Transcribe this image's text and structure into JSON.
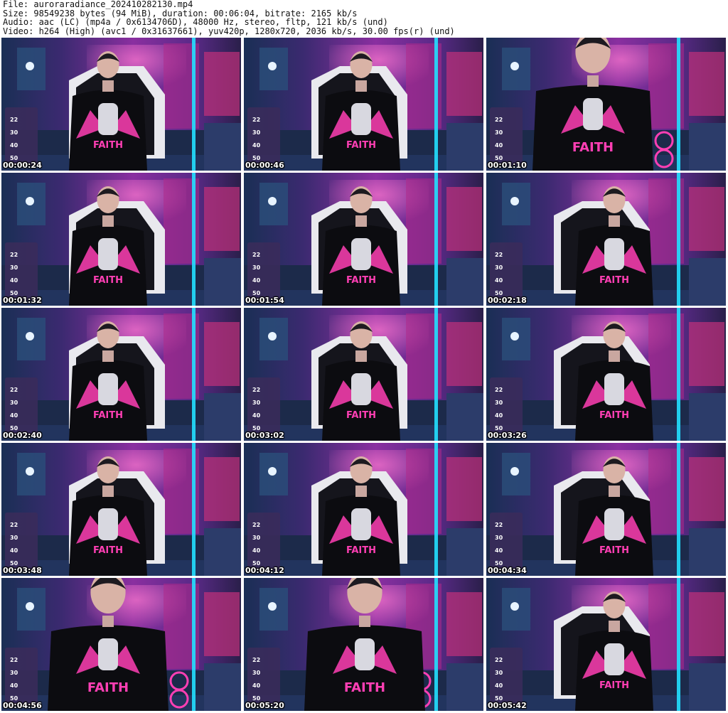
{
  "header": {
    "file": "File: auroraradiance_202410282130.mp4",
    "size": "Size: 98549238 bytes (94 MiB), duration: 00:06:04, bitrate: 2165 kb/s",
    "audio": "Audio: aac (LC) (mp4a / 0x6134706D), 48000 Hz, stereo, fltp, 121 kb/s (und)",
    "video": "Video: h264 (High) (avc1 / 0x31637661), yuv420p, 1280x720, 2036 kb/s, 30.00 fps(r) (und)"
  },
  "thumbnails": [
    {
      "time": "00:00:24",
      "shot": "wide"
    },
    {
      "time": "00:00:46",
      "shot": "wide"
    },
    {
      "time": "00:01:10",
      "shot": "close"
    },
    {
      "time": "00:01:32",
      "shot": "wide"
    },
    {
      "time": "00:01:54",
      "shot": "wide"
    },
    {
      "time": "00:02:18",
      "shot": "wide"
    },
    {
      "time": "00:02:40",
      "shot": "wide"
    },
    {
      "time": "00:03:02",
      "shot": "wide"
    },
    {
      "time": "00:03:26",
      "shot": "wide"
    },
    {
      "time": "00:03:48",
      "shot": "wide"
    },
    {
      "time": "00:04:12",
      "shot": "wide"
    },
    {
      "time": "00:04:34",
      "shot": "wide"
    },
    {
      "time": "00:04:56",
      "shot": "close"
    },
    {
      "time": "00:05:20",
      "shot": "close"
    },
    {
      "time": "00:05:42",
      "shot": "wide"
    }
  ],
  "overlay": {
    "panel_numbers": [
      "22",
      "30",
      "40",
      "50"
    ],
    "shirt_text": "FAITH"
  },
  "colors": {
    "neon_pink": "#ff3fb4",
    "neon_cyan": "#22e0ff",
    "purple": "#6a2fb0",
    "shirt": "#0c0c10"
  }
}
